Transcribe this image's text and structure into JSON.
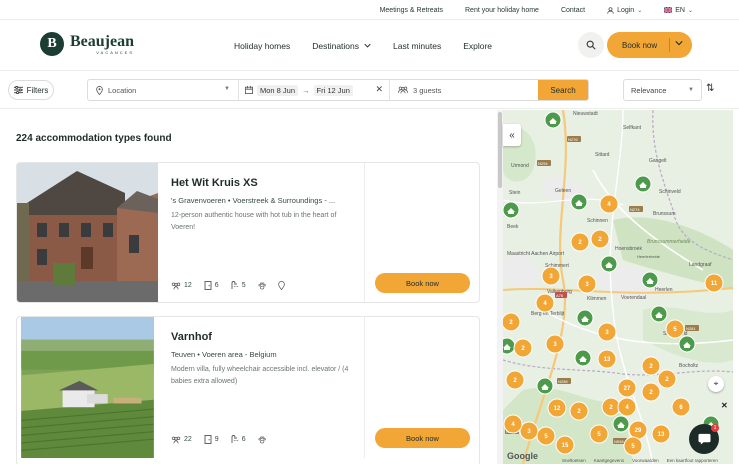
{
  "topbar": {
    "links": [
      "Meetings & Retreats",
      "Rent your holiday home",
      "Contact"
    ],
    "login": "Login",
    "language": "EN"
  },
  "header": {
    "logo_letter": "B",
    "logo_name": "Beaujean",
    "logo_sub": "VACANCES",
    "nav": [
      {
        "label": "Holiday homes"
      },
      {
        "label": "Destinations"
      },
      {
        "label": "Last minutes"
      },
      {
        "label": "Explore"
      }
    ],
    "book_label": "Book now"
  },
  "filterbar": {
    "filters_label": "Filters",
    "location_placeholder": "Location",
    "date_from": "Mon 8 Jun",
    "date_to": "Fri 12 Jun",
    "date_arrow": "→",
    "guests": "3 guests",
    "search_label": "Search",
    "sort_value": "Relevance"
  },
  "results": {
    "count_text": "224 accommodation types found",
    "cards": [
      {
        "title": "Het Wit Kruis XS",
        "location": "'s Gravenvoeren • Voerstreek & Surroundings - ...",
        "description": "12-person authentic house with hot tub in the heart of Voeren!",
        "persons": "12",
        "bedrooms": "6",
        "bathrooms": "5",
        "book_label": "Book now"
      },
      {
        "title": "Varnhof",
        "location": "Teuven • Voeren area - Belgium",
        "description": "Modern villa, fully wheelchair accessible incl. elevator / (4 babies extra allowed)",
        "persons": "22",
        "bedrooms": "9",
        "bathrooms": "6",
        "book_label": "Book now"
      }
    ]
  },
  "map": {
    "place_labels": [
      "Nieuwstadt",
      "Selfkant",
      "Sittard",
      "Gangelt",
      "Urmond",
      "Schinveld",
      "Stein",
      "Geleen",
      "Schinnen",
      "Brunssum",
      "Beek",
      "Hoensbroek",
      "Brunssummerheide",
      "Heerlerheide",
      "Maastricht Aachen Airport",
      "Landgraaf",
      "Schimmert",
      "Heerlen",
      "Valkenburg",
      "Klimmen",
      "Voerendaal",
      "Berg en Terblijt",
      "Simpelveld",
      "Bocholtz"
    ],
    "road_labels": [
      "N276",
      "N294",
      "N274",
      "A76",
      "N298",
      "N281",
      "N595",
      "N598"
    ],
    "cluster_counts": [
      "4",
      "2",
      "2",
      "3",
      "3",
      "4",
      "11",
      "2",
      "3",
      "2",
      "3",
      "5",
      "13",
      "2",
      "2",
      "27",
      "2",
      "2",
      "12",
      "2",
      "2",
      "4",
      "6",
      "3",
      "4",
      "5",
      "5",
      "29",
      "13",
      "15",
      "5"
    ],
    "chat_badge": "1",
    "google": "Google",
    "attribution": [
      "Sneltoetsen",
      "Kaartgegevens",
      "Voorwaarden",
      "Een kaartfout rapporteren"
    ]
  }
}
